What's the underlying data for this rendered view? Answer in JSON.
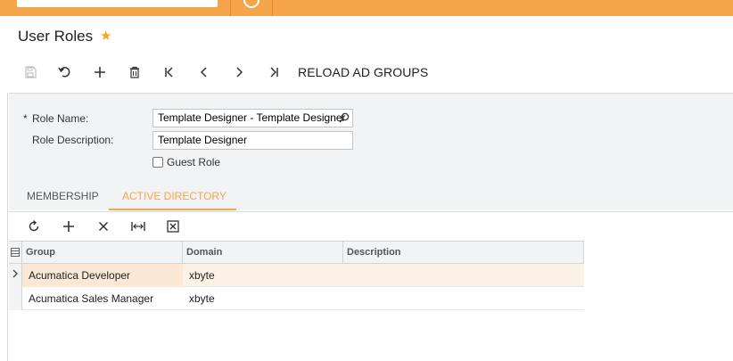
{
  "page": {
    "title": "User Roles"
  },
  "toolbar": {
    "reload_ad_groups_label": "RELOAD AD GROUPS",
    "icons": [
      "save-icon",
      "undo-icon",
      "add-icon",
      "delete-icon",
      "first-icon",
      "previous-icon",
      "next-icon",
      "last-icon"
    ]
  },
  "form": {
    "role_name_label": "Role Name:",
    "role_name_required": "*",
    "role_name_value": "Template Designer - Template Designer",
    "role_description_label": "Role Description:",
    "role_description_value": "Template Designer",
    "guest_role_label": "Guest Role",
    "guest_role_checked": false
  },
  "tabs": [
    {
      "label": "MEMBERSHIP",
      "active": false
    },
    {
      "label": "ACTIVE DIRECTORY",
      "active": true
    }
  ],
  "grid": {
    "toolbar_icons": [
      "refresh-icon",
      "add-row-icon",
      "delete-row-icon",
      "fit-columns-icon",
      "export-excel-icon"
    ],
    "columns": [
      "Group",
      "Domain",
      "Description"
    ],
    "rows": [
      {
        "group": "Acumatica Developer",
        "domain": "xbyte",
        "description": "",
        "selected": true
      },
      {
        "group": "Acumatica Sales Manager",
        "domain": "xbyte",
        "description": "",
        "selected": false
      }
    ]
  },
  "colors": {
    "accent": "#f5a54a",
    "star": "#f5a623",
    "selected_row": "#fdf2e6",
    "panel_bg": "#f2f3f5"
  }
}
